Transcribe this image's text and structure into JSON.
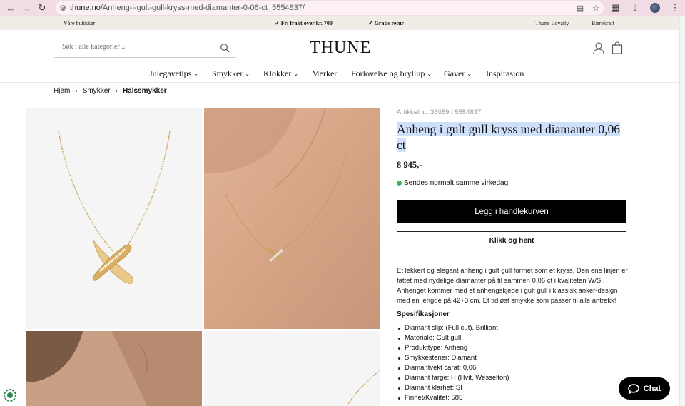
{
  "browser": {
    "url_host": "thune.no",
    "url_path": "/Anheng-i-gult-gull-kryss-med-diamanter-0-06-ct_5554837/"
  },
  "topbar": {
    "stores": "Våre butikker",
    "shipping": "✓ Fri frakt over kr. 700",
    "returns": "✓ Gratis retur",
    "loyalty": "Thune Loyalty",
    "sustainability": "Bærekraft"
  },
  "header": {
    "search_placeholder": "Søk i alle kategorier ...",
    "logo": "THUNE"
  },
  "nav": {
    "items": [
      {
        "label": "Julegavetips"
      },
      {
        "label": "Smykker"
      },
      {
        "label": "Klokker"
      },
      {
        "label": "Merker"
      },
      {
        "label": "Forlovelse og bryllup"
      },
      {
        "label": "Gaver"
      },
      {
        "label": "Inspirasjon"
      }
    ]
  },
  "breadcrumb": {
    "items": [
      "Hjem",
      "Smykker",
      "Halssmykker"
    ]
  },
  "product": {
    "article_number": "Artikkelnr.: 36059 / 5554837",
    "title": "Anheng i gult gull kryss med diamanter 0,06 ct",
    "price": "8 945,-",
    "stock": "Sendes normalt samme virkedag",
    "add_to_cart": "Legg i handlekurven",
    "click_collect": "Klikk og hent",
    "description": "Et lekkert og elegant anheng i gult gull formet som et kryss. Den ene linjen er fattet med nydelige diamanter på til sammen 0,06 ct i kvaliteten W/SI. Anhenget kommer med et anhengskjede i gult gull i klassisk anker-design med en lengde på 42+3 cm. Et tidløst smykke som passer til alle antrekk!",
    "spec_heading": "Spesifikasjoner",
    "specs": [
      "Diamant slip: (Full cut), Brilliant",
      "Materiale: Gult gull",
      "Produkttype: Anheng",
      "Smykkestener: Diamant",
      "Diamantvekt carat: 0,06",
      "Diamant farge: H (Hvit, Wesselton)",
      "Diamant klarhet: SI",
      "Finhet/Kvalitet: 585"
    ]
  },
  "chat": {
    "label": "Chat"
  }
}
